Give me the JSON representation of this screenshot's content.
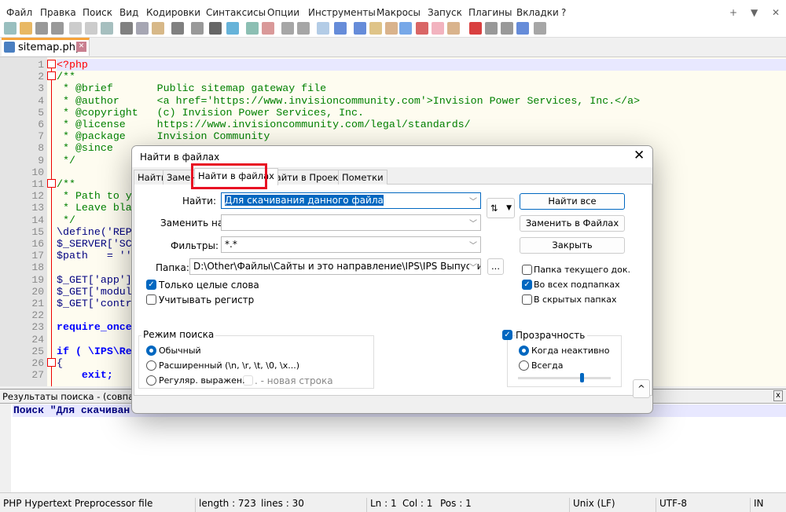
{
  "menu": [
    "Файл",
    "Правка",
    "Поиск",
    "Вид",
    "Кодировки",
    "Синтаксисы",
    "Опции",
    "Инструменты",
    "Макросы",
    "Запуск",
    "Плагины",
    "Вкладки",
    "?"
  ],
  "window_controls": {
    "add": "+",
    "dropdown": "▼",
    "close": "✕"
  },
  "file_tab": {
    "name": "sitemap.php",
    "close": "✕"
  },
  "code_lines": [
    "<?php",
    "/**",
    " * @brief       Public sitemap gateway file",
    " * @author      <a href='https://www.invisioncommunity.com'>Invision Power Services, Inc.</a>",
    " * @copyright   (c) Invision Power Services, Inc.",
    " * @license     https://www.invisioncommunity.com/legal/standards/",
    " * @package     Invision Community",
    " * @since",
    " */",
    "",
    "/**",
    " * Path to y",
    " * Leave bla",
    " */",
    "\\define('REP",
    "$_SERVER['SC",
    "$path   = ''",
    "",
    "$_GET['app']",
    "$_GET['modul",
    "$_GET['contr",
    "",
    "require_once",
    "",
    "if ( \\IPS\\Re",
    "{",
    "    exit;"
  ],
  "results": {
    "title": "Результаты поиска - (совпаден",
    "close": "x",
    "line": "Поиск \"Для скачиван"
  },
  "status": {
    "type": "PHP Hypertext Preprocessor file",
    "length": "length : 723",
    "lines": "lines : 30",
    "ln": "Ln : 1",
    "col": "Col : 1",
    "pos": "Pos : 1",
    "eol": "Unix (LF)",
    "encoding": "UTF-8",
    "mode": "IN"
  },
  "dialog": {
    "title": "Найти в файлах",
    "close": "✕",
    "tabs": [
      "Найти",
      "Замена",
      "Найти в файлах",
      "Найти в Проектах",
      "Пометки"
    ],
    "active_tab": "Найти в файлах",
    "find_label": "Найти:",
    "find_value": "Для скачивания данного файла",
    "replace_label": "Заменить на:",
    "replace_value": "",
    "filters_label": "Фильтры:",
    "filters_value": "*.*",
    "folder_label": "Папка:",
    "folder_value": "D:\\Other\\Файлы\\Сайты и это направление\\IPS\\IPS Выпуски",
    "browse": "...",
    "swap": "⇅",
    "buttons": {
      "find_all": "Найти все",
      "replace_in_files": "Заменить в Файлах",
      "close": "Закрыть"
    },
    "options": [
      {
        "label": "Только целые слова",
        "checked": true
      },
      {
        "label": "Учитывать регистр",
        "checked": false
      }
    ],
    "folder_options": [
      {
        "label": "Папка текущего док.",
        "checked": false
      },
      {
        "label": "Во всех подпапках",
        "checked": true
      },
      {
        "label": "В скрытых папках",
        "checked": false
      }
    ],
    "search_mode": {
      "title": "Режим поиска",
      "modes": [
        {
          "label": "Обычный",
          "selected": true
        },
        {
          "label": "Расширенный (\\n, \\r, \\t, \\0, \\x...)",
          "selected": false
        },
        {
          "label": "Регуляр. выражен.",
          "selected": false
        }
      ],
      "newline_label": ". - новая строка"
    },
    "transparency": {
      "label": "Прозрачность",
      "checked": true,
      "modes": [
        {
          "label": "Когда неактивно",
          "selected": true
        },
        {
          "label": "Всегда",
          "selected": false
        }
      ],
      "level": 0.7
    },
    "collapse": "^",
    "highlight_color": "#e81123"
  }
}
